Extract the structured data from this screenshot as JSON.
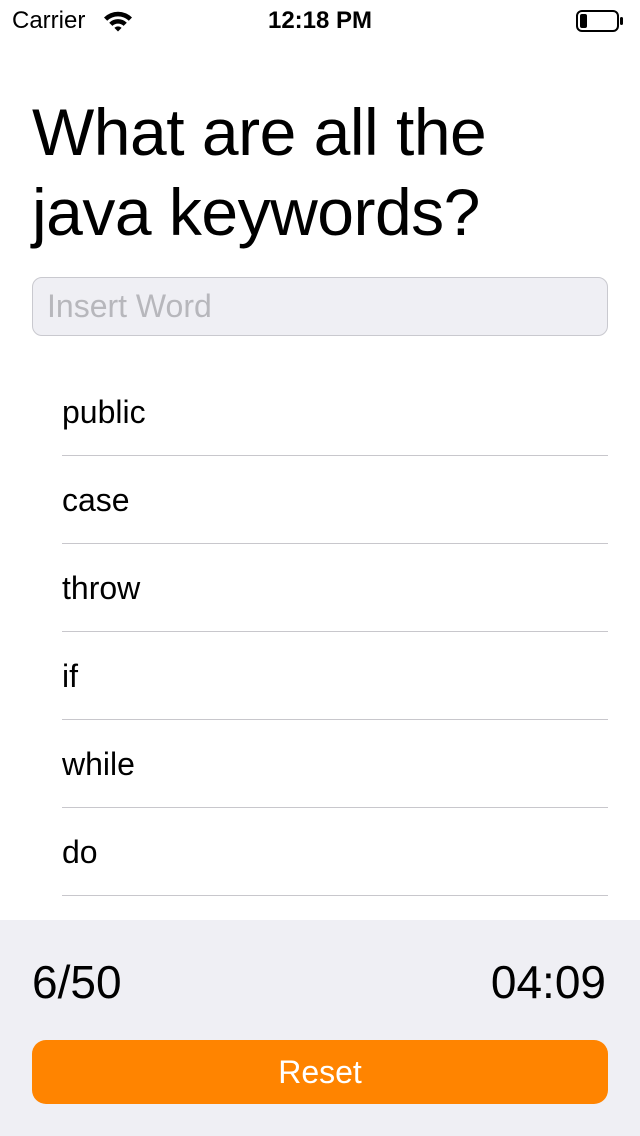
{
  "status_bar": {
    "carrier": "Carrier",
    "time": "12:18 PM",
    "wifi_icon": "wifi-icon",
    "battery_icon": "battery-low-icon",
    "battery_level": 0.2
  },
  "question": {
    "title": "What are all the java keywords?"
  },
  "input": {
    "placeholder": "Insert Word",
    "value": ""
  },
  "words": [
    {
      "label": "public"
    },
    {
      "label": "case"
    },
    {
      "label": "throw"
    },
    {
      "label": "if"
    },
    {
      "label": "while"
    },
    {
      "label": "do"
    }
  ],
  "footer": {
    "score": "6/50",
    "timer": "04:09",
    "reset_label": "Reset"
  },
  "colors": {
    "accent": "#ff8400",
    "footer_background": "#efeff4",
    "input_background": "#efeff4",
    "separator": "#c8c7cc"
  }
}
